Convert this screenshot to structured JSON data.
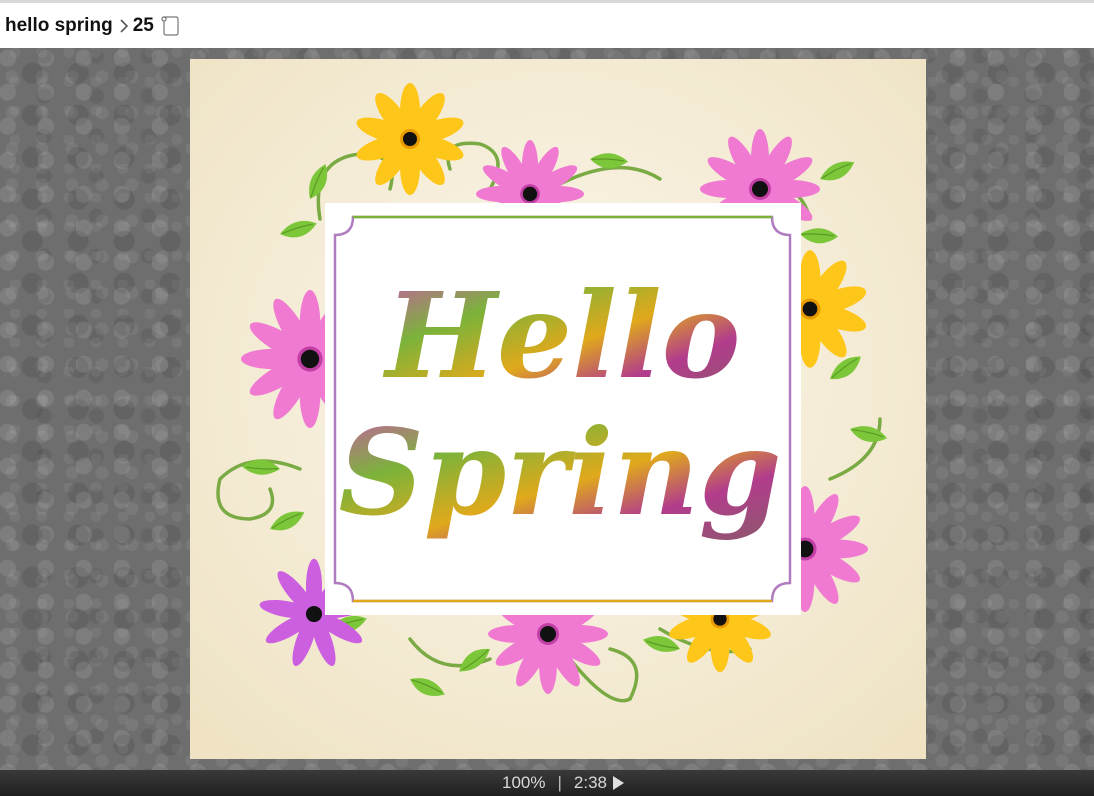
{
  "breadcrumb": {
    "album": "hello spring",
    "separator_icon": "chevron-right-icon",
    "count": "25",
    "scroll_icon": "scroll-icon"
  },
  "image": {
    "headline_line1": "Hello",
    "headline_line2": "Spring",
    "background_color": "#f4ecd6",
    "card_color": "#ffffff"
  },
  "status": {
    "zoom": "100%",
    "divider": "|",
    "elapsed": "2:38",
    "play_icon": "play-icon"
  }
}
